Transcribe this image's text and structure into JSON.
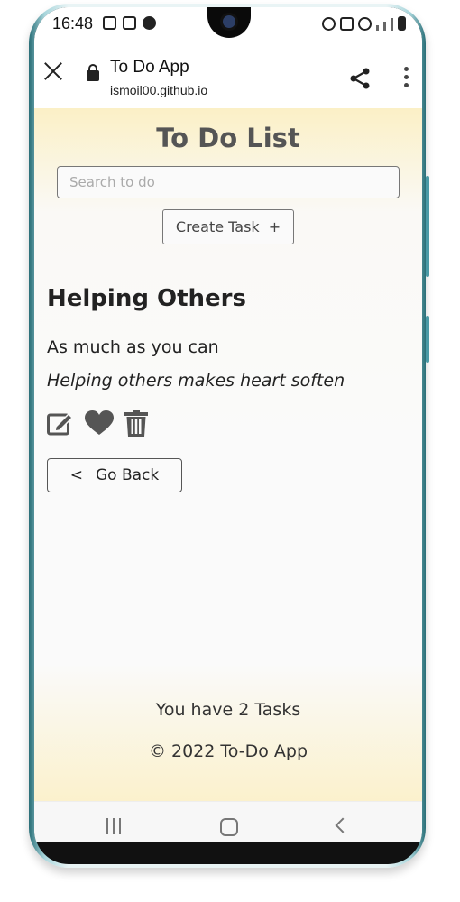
{
  "status_bar": {
    "time": "16:48"
  },
  "browser": {
    "title": "To Do App",
    "url": "ismoil00.github.io"
  },
  "app": {
    "title": "To Do List",
    "search_placeholder": "Search to do",
    "create_button": "Create Task",
    "create_icon": "+",
    "task": {
      "title": "Helping Others",
      "subtitle": "As much as you can",
      "description": "Helping others makes heart soften"
    },
    "back_icon": "<",
    "back_button": "Go Back",
    "footer_count": "You have 2 Tasks",
    "footer_copyright": "© 2022 To-Do App"
  },
  "icons": {
    "edit": "edit-icon",
    "like": "heart-icon",
    "delete": "trash-icon",
    "share": "share-icon",
    "menu": "more-vert-icon",
    "close": "close-icon",
    "lock": "lock-icon"
  }
}
